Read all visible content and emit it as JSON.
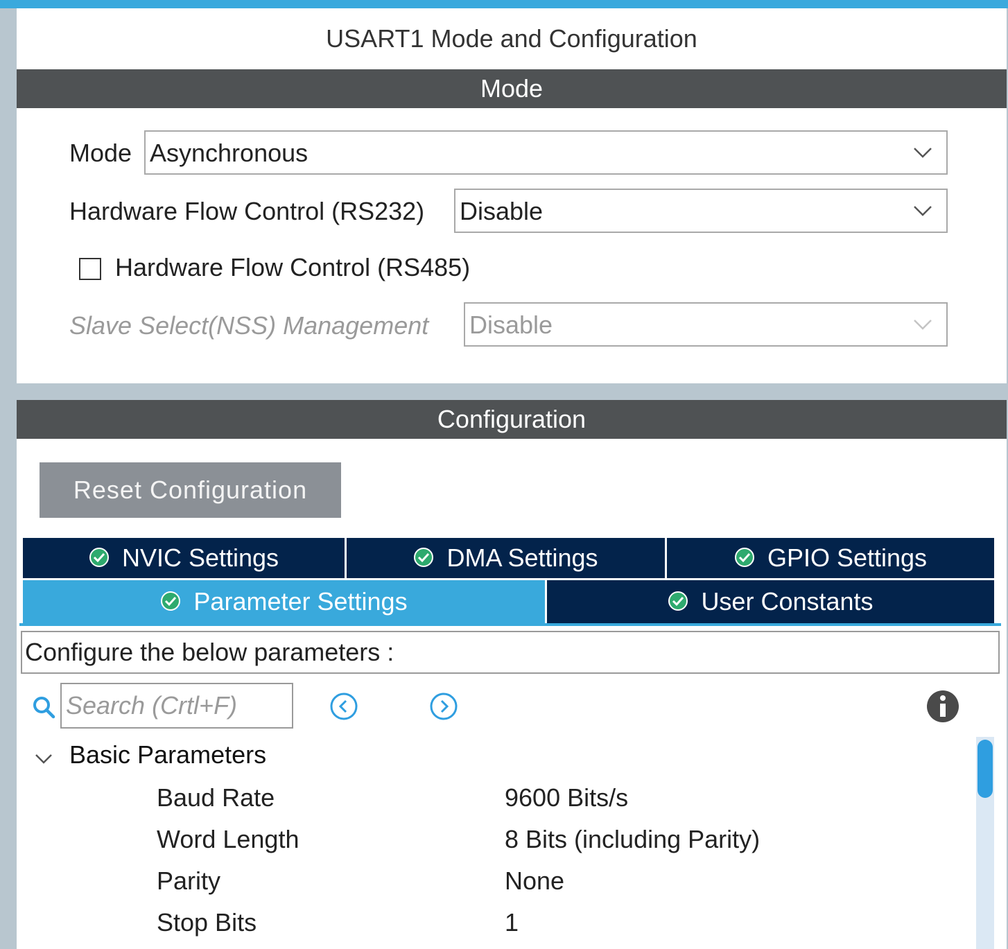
{
  "panel": {
    "title": "USART1 Mode and Configuration"
  },
  "mode_section": {
    "header": "Mode",
    "mode_label": "Mode",
    "mode_value": "Asynchronous",
    "rs232_label": "Hardware Flow Control (RS232)",
    "rs232_value": "Disable",
    "rs485_label": "Hardware Flow Control (RS485)",
    "rs485_checked": false,
    "nss_label": "Slave Select(NSS) Management",
    "nss_value": "Disable"
  },
  "config_section": {
    "header": "Configuration",
    "reset_label": "Reset Configuration",
    "tabs": [
      {
        "label": "NVIC Settings",
        "active": false
      },
      {
        "label": "DMA Settings",
        "active": false
      },
      {
        "label": "GPIO Settings",
        "active": false
      },
      {
        "label": "Parameter Settings",
        "active": true
      },
      {
        "label": "User Constants",
        "active": false
      }
    ],
    "configure_text": "Configure the below parameters :",
    "search_placeholder": "Search (Crtl+F)",
    "group": "Basic Parameters",
    "params": [
      {
        "name": "Baud Rate",
        "value": "9600 Bits/s"
      },
      {
        "name": "Word Length",
        "value": "8 Bits (including Parity)"
      },
      {
        "name": "Parity",
        "value": "None"
      },
      {
        "name": "Stop Bits",
        "value": "1"
      }
    ]
  },
  "colors": {
    "accent": "#39a9dc",
    "tab_dark": "#03234b",
    "section_bar": "#4f5254",
    "check_green": "#2eaa6e"
  },
  "icons": {
    "dropdown": "chevron-down-icon",
    "tab_status": "check-circle-icon",
    "search": "search-icon",
    "previous": "chevron-left-circle-icon",
    "next": "chevron-right-circle-icon",
    "info": "info-icon",
    "tree": "chevron-down-icon"
  }
}
